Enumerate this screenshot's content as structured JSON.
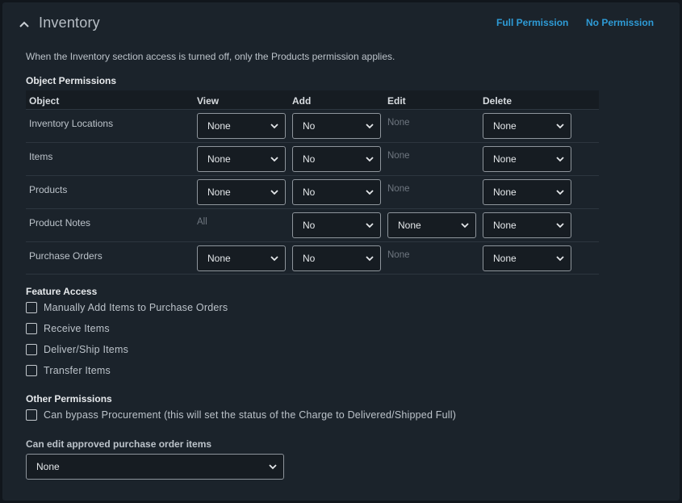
{
  "section": {
    "title": "Inventory",
    "full_permission": "Full Permission",
    "no_permission": "No Permission",
    "note": "When the Inventory section access is turned off, only the Products permission applies."
  },
  "object_permissions": {
    "title": "Object Permissions",
    "headers": {
      "object": "Object",
      "view": "View",
      "add": "Add",
      "edit": "Edit",
      "delete": "Delete"
    },
    "rows": [
      {
        "object": "Inventory Locations",
        "view": "None",
        "add": "No",
        "edit": "None",
        "delete": "None"
      },
      {
        "object": "Items",
        "view": "None",
        "add": "No",
        "edit": "None",
        "delete": "None"
      },
      {
        "object": "Products",
        "view": "None",
        "add": "No",
        "edit": "None",
        "delete": "None"
      },
      {
        "object": "Product Notes",
        "view": "All",
        "add": "No",
        "edit": "None",
        "delete": "None"
      },
      {
        "object": "Purchase Orders",
        "view": "None",
        "add": "No",
        "edit": "None",
        "delete": "None"
      }
    ]
  },
  "feature_access": {
    "title": "Feature Access",
    "items": [
      {
        "label": "Manually Add Items to Purchase Orders",
        "checked": false
      },
      {
        "label": "Receive Items",
        "checked": false
      },
      {
        "label": "Deliver/Ship Items",
        "checked": false
      },
      {
        "label": "Transfer Items",
        "checked": false
      }
    ]
  },
  "other_permissions": {
    "title": "Other Permissions",
    "items": [
      {
        "label": "Can bypass Procurement (this will set the status of the Charge to Delivered/Shipped Full)",
        "checked": false
      }
    ]
  },
  "approved_po_items": {
    "label": "Can edit approved purchase order items",
    "value": "None"
  },
  "colors": {
    "background": "#11161c",
    "panel": "#1b232b",
    "link": "#2e9bd6",
    "border": "#8e959c"
  }
}
